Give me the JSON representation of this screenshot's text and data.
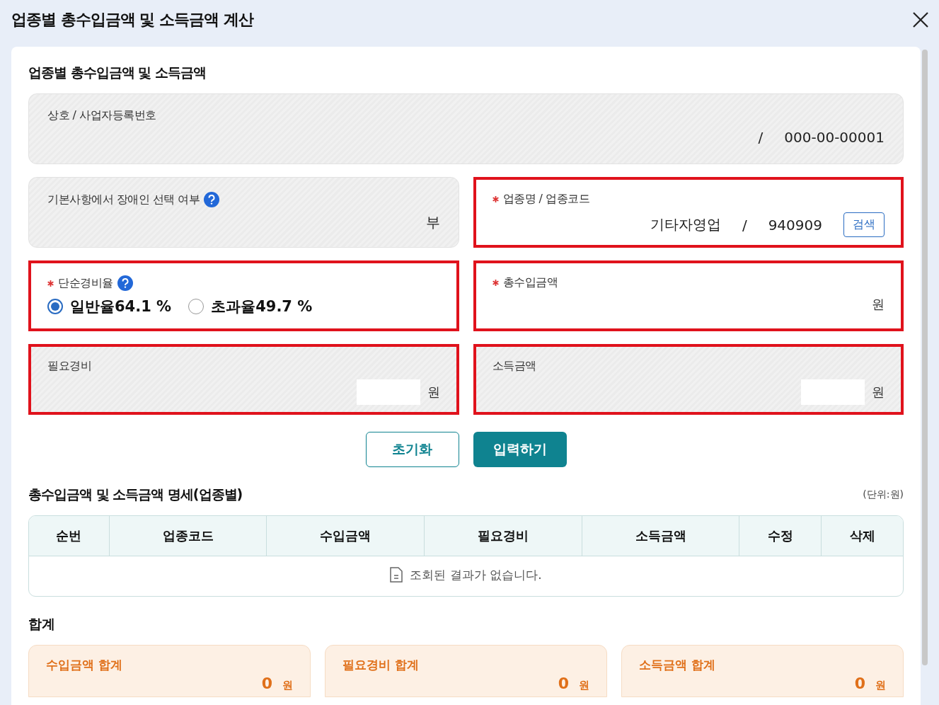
{
  "dialog": {
    "title": "업종별 총수입금액 및 소득금액 계산"
  },
  "section_title": "업종별 총수입금액 및 소득금액",
  "fields": [
    {
      "label": "상호 / 사업자등록번호",
      "kind": "readonly",
      "wide": true,
      "required": false,
      "help": false,
      "highlighted": false,
      "items": [
        {
          "kind": "text",
          "text": "/"
        },
        {
          "kind": "text",
          "text": "000-00-00001"
        }
      ]
    },
    {
      "label": "기본사항에서 장애인 선택 여부",
      "kind": "readonly",
      "wide": false,
      "required": false,
      "help": true,
      "highlighted": false,
      "items": [
        {
          "kind": "text",
          "text": "부"
        }
      ]
    },
    {
      "label": "업종명 / 업종코드",
      "kind": "input",
      "wide": false,
      "required": true,
      "help": false,
      "highlighted": true,
      "items": [
        {
          "kind": "text",
          "text": "기타자영업"
        },
        {
          "kind": "text",
          "text": "/"
        },
        {
          "kind": "text",
          "text": "940909"
        },
        {
          "kind": "button",
          "text": "검색"
        }
      ]
    },
    {
      "label": "단순경비율",
      "kind": "input",
      "wide": false,
      "required": true,
      "help": true,
      "highlighted": true,
      "items": [
        {
          "kind": "radio",
          "text": "일반율64.1 %",
          "selected": true
        },
        {
          "kind": "radio",
          "text": "초과율49.7 %",
          "selected": false
        }
      ]
    },
    {
      "label": "총수입금액",
      "kind": "input",
      "wide": false,
      "required": true,
      "help": false,
      "highlighted": true,
      "items": [
        {
          "kind": "unit",
          "text": "원"
        }
      ]
    },
    {
      "label": "필요경비",
      "kind": "readonly",
      "wide": false,
      "required": false,
      "help": false,
      "highlighted": true,
      "items": [
        {
          "kind": "blank"
        },
        {
          "kind": "unit",
          "text": "원"
        }
      ]
    },
    {
      "label": "소득금액",
      "kind": "readonly",
      "wide": false,
      "required": false,
      "help": false,
      "highlighted": true,
      "items": [
        {
          "kind": "blank"
        },
        {
          "kind": "unit",
          "text": "원"
        }
      ]
    }
  ],
  "buttons": [
    {
      "label": "초기화",
      "kind": "secondary"
    },
    {
      "label": "입력하기",
      "kind": "primary"
    }
  ],
  "table": {
    "title": "총수입금액 및 소득금액 명세(업종별)",
    "unit_note": "(단위:원)",
    "columns": [
      "순번",
      "업종코드",
      "수입금액",
      "필요경비",
      "소득금액",
      "수정",
      "삭제"
    ],
    "empty_message": "조회된 결과가 없습니다."
  },
  "totals": {
    "title": "합계",
    "cards": [
      {
        "label": "수입금액 합계",
        "value": "0",
        "unit": "원"
      },
      {
        "label": "필요경비 합계",
        "value": "0",
        "unit": "원"
      },
      {
        "label": "소득금액 합계",
        "value": "0",
        "unit": "원"
      }
    ]
  }
}
